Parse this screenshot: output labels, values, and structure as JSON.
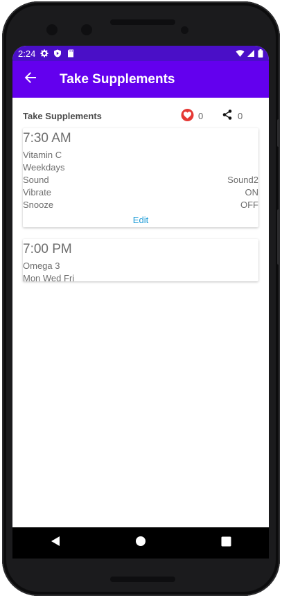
{
  "status_bar": {
    "time": "2:24",
    "icons_left": [
      "gear-icon",
      "shield-play-icon",
      "sd-card-icon"
    ],
    "icons_right": [
      "wifi-icon",
      "cell-signal-icon",
      "battery-icon"
    ]
  },
  "app_bar": {
    "title": "Take Supplements",
    "back_icon": "arrow-back-icon",
    "color": "#6300ee",
    "status_color": "#4a0fc7"
  },
  "header": {
    "title": "Take Supplements",
    "likes": "0",
    "shares": "0",
    "heart_color": "#e53935"
  },
  "alarms": [
    {
      "time": "7:30 AM",
      "name": "Vitamin C",
      "days": "Weekdays",
      "sound_label": "Sound",
      "sound_value": "Sound2",
      "vibrate_label": "Vibrate",
      "vibrate_value": "ON",
      "snooze_label": "Snooze",
      "snooze_value": "OFF",
      "edit_label": "Edit"
    },
    {
      "time": "7:00 PM",
      "name": "Omega 3",
      "days": "Mon Wed Fri"
    }
  ],
  "nav_bar": {
    "icons": [
      "back-triangle-icon",
      "home-circle-icon",
      "recents-square-icon"
    ]
  },
  "colors": {
    "link": "#1a9ad6"
  }
}
